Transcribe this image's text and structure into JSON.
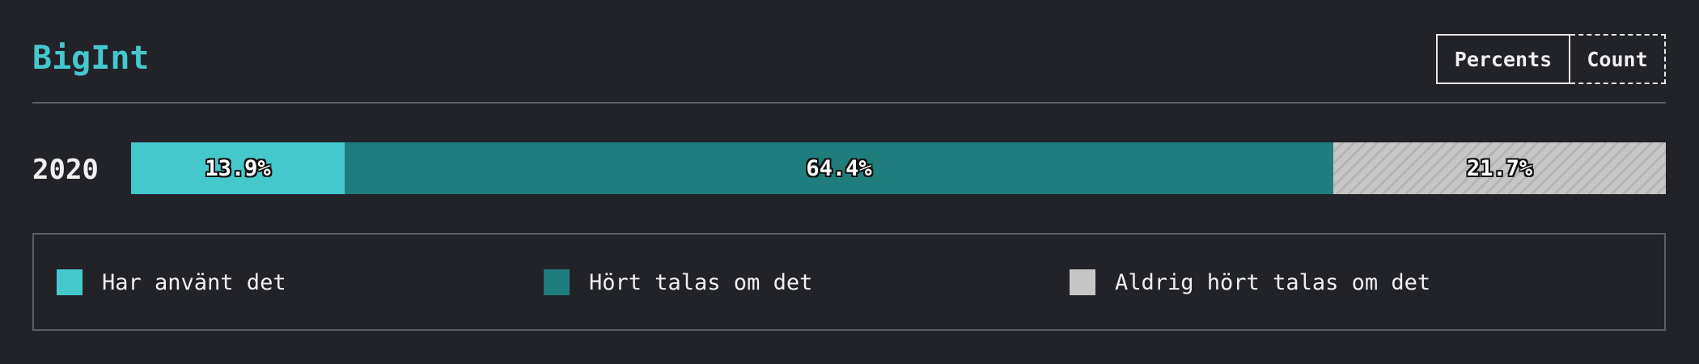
{
  "header": {
    "title": "BigInt",
    "toggle": {
      "percents_label": "Percents",
      "count_label": "Count",
      "selected": "Percents"
    }
  },
  "colors": {
    "accent": "#44c8cc",
    "used": "#44c8cc",
    "heard": "#1f7d7d",
    "never": "#c6c6c6",
    "background": "#222329"
  },
  "chart_data": {
    "type": "bar",
    "orientation": "horizontal",
    "stacked": true,
    "title": "BigInt",
    "categories": [
      "2020"
    ],
    "series": [
      {
        "name": "Har använt det",
        "values": [
          13.9
        ],
        "label": "13.9%",
        "color": "#44c8cc",
        "pattern": "solid"
      },
      {
        "name": "Hört talas om det",
        "values": [
          64.4
        ],
        "label": "64.4%",
        "color": "#1f7d7d",
        "pattern": "solid"
      },
      {
        "name": "Aldrig hört talas om det",
        "values": [
          21.7
        ],
        "label": "21.7%",
        "color": "#c6c6c6",
        "pattern": "diagonal-stripes"
      }
    ],
    "units": "percent",
    "xlim": [
      0,
      100
    ],
    "legend_placement": "bottom"
  }
}
